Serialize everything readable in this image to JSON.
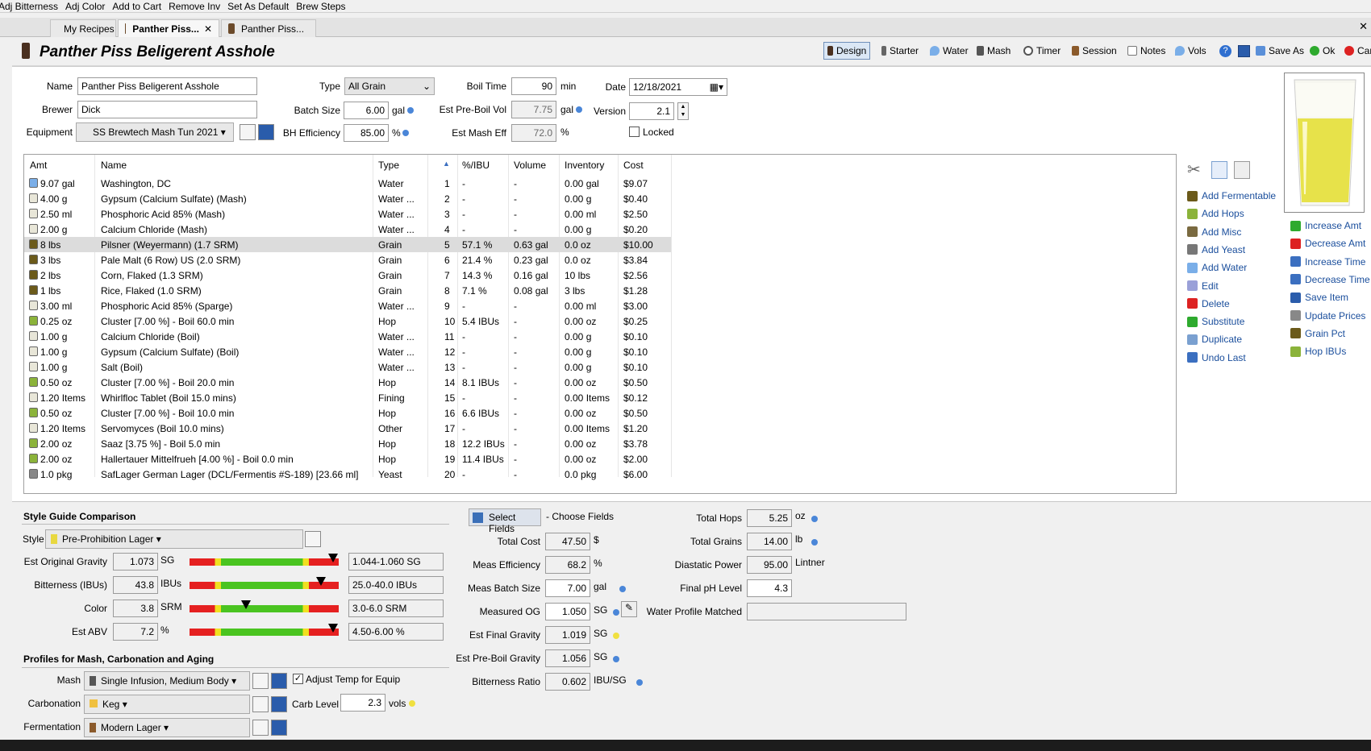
{
  "menu": [
    "Adj Bitterness",
    "Adj Color",
    "Add to Cart",
    "Remove Inv",
    "Set As Default",
    "Brew Steps"
  ],
  "tabs": [
    "My Recipes",
    "Panther Piss...",
    "Panther Piss..."
  ],
  "title": "Panther Piss Beligerent Asshole",
  "toolbar": [
    "Design",
    "Starter",
    "Water",
    "Mash",
    "Timer",
    "Session",
    "Notes",
    "Vols",
    "Save As",
    "Ok",
    "Cancel"
  ],
  "form": {
    "name_label": "Name",
    "name": "Panther Piss Beligerent Asshole",
    "brewer_label": "Brewer",
    "brewer": "Dick",
    "equipment_label": "Equipment",
    "equipment": "SS Brewtech Mash Tun 2021",
    "type_label": "Type",
    "type": "All Grain",
    "batch_label": "Batch Size",
    "batch": "6.00",
    "batch_unit": "gal",
    "bh_label": "BH Efficiency",
    "bh": "85.00",
    "bh_unit": "%",
    "boil_label": "Boil Time",
    "boil": "90",
    "boil_unit": "min",
    "preboil_label": "Est Pre-Boil Vol",
    "preboil": "7.75",
    "preboil_unit": "gal",
    "masheff_label": "Est Mash Eff",
    "masheff": "72.0",
    "masheff_unit": "%",
    "date_label": "Date",
    "date": "12/18/2021",
    "version_label": "Version",
    "version": "2.1",
    "locked_label": "Locked"
  },
  "grid_headers": [
    "Amt",
    "Name",
    "Type",
    "",
    "%/IBU",
    "Volume",
    "Inventory",
    "Cost"
  ],
  "ingredients": [
    {
      "amt": "9.07 gal",
      "name": "Washington, DC",
      "type": "Water",
      "n": "1",
      "pct": "-",
      "vol": "-",
      "inv": "0.00 gal",
      "cost": "$9.07"
    },
    {
      "amt": "4.00 g",
      "name": "Gypsum (Calcium Sulfate) (Mash)",
      "type": "Water ...",
      "n": "2",
      "pct": "-",
      "vol": "-",
      "inv": "0.00 g",
      "cost": "$0.40"
    },
    {
      "amt": "2.50 ml",
      "name": "Phosphoric Acid 85% (Mash)",
      "type": "Water ...",
      "n": "3",
      "pct": "-",
      "vol": "-",
      "inv": "0.00 ml",
      "cost": "$2.50"
    },
    {
      "amt": "2.00 g",
      "name": "Calcium Chloride (Mash)",
      "type": "Water ...",
      "n": "4",
      "pct": "-",
      "vol": "-",
      "inv": "0.00 g",
      "cost": "$0.20"
    },
    {
      "amt": "8 lbs",
      "name": "Pilsner (Weyermann) (1.7 SRM)",
      "type": "Grain",
      "n": "5",
      "pct": "57.1 %",
      "vol": "0.63 gal",
      "inv": "0.0 oz",
      "cost": "$10.00"
    },
    {
      "amt": "3 lbs",
      "name": "Pale Malt (6 Row) US (2.0 SRM)",
      "type": "Grain",
      "n": "6",
      "pct": "21.4 %",
      "vol": "0.23 gal",
      "inv": "0.0 oz",
      "cost": "$3.84"
    },
    {
      "amt": "2 lbs",
      "name": "Corn, Flaked (1.3 SRM)",
      "type": "Grain",
      "n": "7",
      "pct": "14.3 %",
      "vol": "0.16 gal",
      "inv": "10 lbs",
      "cost": "$2.56"
    },
    {
      "amt": "1 lbs",
      "name": "Rice, Flaked (1.0 SRM)",
      "type": "Grain",
      "n": "8",
      "pct": "7.1 %",
      "vol": "0.08 gal",
      "inv": "3 lbs",
      "cost": "$1.28"
    },
    {
      "amt": "3.00 ml",
      "name": "Phosphoric Acid 85% (Sparge)",
      "type": "Water ...",
      "n": "9",
      "pct": "-",
      "vol": "-",
      "inv": "0.00 ml",
      "cost": "$3.00"
    },
    {
      "amt": "0.25 oz",
      "name": "Cluster [7.00 %] - Boil 60.0 min",
      "type": "Hop",
      "n": "10",
      "pct": "5.4 IBUs",
      "vol": "-",
      "inv": "0.00 oz",
      "cost": "$0.25"
    },
    {
      "amt": "1.00 g",
      "name": "Calcium Chloride (Boil)",
      "type": "Water ...",
      "n": "11",
      "pct": "-",
      "vol": "-",
      "inv": "0.00 g",
      "cost": "$0.10"
    },
    {
      "amt": "1.00 g",
      "name": "Gypsum (Calcium Sulfate) (Boil)",
      "type": "Water ...",
      "n": "12",
      "pct": "-",
      "vol": "-",
      "inv": "0.00 g",
      "cost": "$0.10"
    },
    {
      "amt": "1.00 g",
      "name": "Salt (Boil)",
      "type": "Water ...",
      "n": "13",
      "pct": "-",
      "vol": "-",
      "inv": "0.00 g",
      "cost": "$0.10"
    },
    {
      "amt": "0.50 oz",
      "name": "Cluster [7.00 %] - Boil 20.0 min",
      "type": "Hop",
      "n": "14",
      "pct": "8.1 IBUs",
      "vol": "-",
      "inv": "0.00 oz",
      "cost": "$0.50"
    },
    {
      "amt": "1.20 Items",
      "name": "Whirlfloc Tablet (Boil 15.0 mins)",
      "type": "Fining",
      "n": "15",
      "pct": "-",
      "vol": "-",
      "inv": "0.00 Items",
      "cost": "$0.12"
    },
    {
      "amt": "0.50 oz",
      "name": "Cluster [7.00 %] - Boil 10.0 min",
      "type": "Hop",
      "n": "16",
      "pct": "6.6 IBUs",
      "vol": "-",
      "inv": "0.00 oz",
      "cost": "$0.50"
    },
    {
      "amt": "1.20 Items",
      "name": "Servomyces (Boil 10.0 mins)",
      "type": "Other",
      "n": "17",
      "pct": "-",
      "vol": "-",
      "inv": "0.00 Items",
      "cost": "$1.20"
    },
    {
      "amt": "2.00 oz",
      "name": "Saaz [3.75 %] - Boil 5.0 min",
      "type": "Hop",
      "n": "18",
      "pct": "12.2 IBUs",
      "vol": "-",
      "inv": "0.00 oz",
      "cost": "$3.78"
    },
    {
      "amt": "2.00 oz",
      "name": "Hallertauer Mittelfrueh [4.00 %] - Boil 0.0 min",
      "type": "Hop",
      "n": "19",
      "pct": "11.4 IBUs",
      "vol": "-",
      "inv": "0.00 oz",
      "cost": "$2.00"
    },
    {
      "amt": "1.0 pkg",
      "name": "SafLager German Lager (DCL/Fermentis #S-189) [23.66 ml]",
      "type": "Yeast",
      "n": "20",
      "pct": "-",
      "vol": "-",
      "inv": "0.0 pkg",
      "cost": "$6.00"
    }
  ],
  "actions_left": [
    "Add Fermentable",
    "Add Hops",
    "Add Misc",
    "Add Yeast",
    "Add Water",
    "Edit",
    "Delete",
    "Substitute",
    "Duplicate",
    "Undo Last"
  ],
  "actions_right": [
    "Increase Amt",
    "Decrease Amt",
    "Increase Time",
    "Decrease Time",
    "Save Item",
    "Update Prices",
    "Grain Pct",
    "Hop IBUs"
  ],
  "style": {
    "section": "Style Guide Comparison",
    "style_label": "Style",
    "style_value": "Pre-Prohibition Lager",
    "rows": [
      {
        "label": "Est Original Gravity",
        "value": "1.073",
        "unit": "SG",
        "range": "1.044-1.060 SG",
        "level": 0.96
      },
      {
        "label": "Bitterness (IBUs)",
        "value": "43.8",
        "unit": "IBUs",
        "range": "25.0-40.0 IBUs",
        "level": 0.88
      },
      {
        "label": "Color",
        "value": "3.8",
        "unit": "SRM",
        "range": "3.0-6.0 SRM",
        "level": 0.38
      },
      {
        "label": "Est ABV",
        "value": "7.2",
        "unit": "%",
        "range": "4.50-6.00 %",
        "level": 0.96
      }
    ]
  },
  "profiles": {
    "section": "Profiles for Mash, Carbonation and Aging",
    "mash_label": "Mash",
    "mash": "Single Infusion, Medium Body",
    "adjust_label": "Adjust Temp for Equip",
    "carb_label": "Carbonation",
    "carb": "Keg",
    "carblevel_label": "Carb Level",
    "carblevel": "2.3",
    "carblevel_unit": "vols",
    "ferm_label": "Fermentation",
    "ferm": "Modern Lager"
  },
  "stats": {
    "select_fields": "Select Fields",
    "choose_fields": "- Choose Fields",
    "rows": [
      {
        "label": "Total Cost",
        "value": "47.50",
        "unit": "$"
      },
      {
        "label": "Meas Efficiency",
        "value": "68.2",
        "unit": "%"
      },
      {
        "label": "Meas Batch Size",
        "value": "7.00",
        "unit": "gal"
      },
      {
        "label": "Measured OG",
        "value": "1.050",
        "unit": "SG"
      },
      {
        "label": "Est Final Gravity",
        "value": "1.019",
        "unit": "SG"
      },
      {
        "label": "Est Pre-Boil Gravity",
        "value": "1.056",
        "unit": "SG"
      },
      {
        "label": "Bitterness Ratio",
        "value": "0.602",
        "unit": "IBU/SG"
      }
    ],
    "right": [
      {
        "label": "Total Hops",
        "value": "5.25",
        "unit": "oz"
      },
      {
        "label": "Total Grains",
        "value": "14.00",
        "unit": "lb"
      },
      {
        "label": "Diastatic Power",
        "value": "95.00",
        "unit": "Lintner"
      },
      {
        "label": "Final pH Level",
        "value": "4.3",
        "unit": ""
      },
      {
        "label": "Water Profile Matched",
        "value": "",
        "unit": ""
      }
    ]
  }
}
